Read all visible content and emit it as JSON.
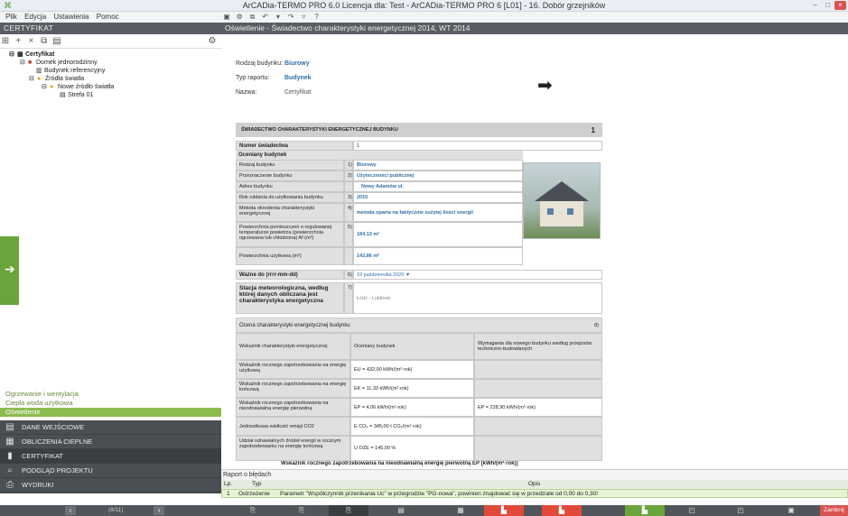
{
  "window": {
    "title": "ArCADia-TERMO PRO 6.0 Licencja dla: Test - ArCADia-TERMO PRO 6 [L01] - 16. Dobór grzejników",
    "minimize": "–",
    "restore": "□",
    "close": "×"
  },
  "menu": [
    "Plik",
    "Edycja",
    "Ustawienia",
    "Pomoc"
  ],
  "left_panel": {
    "header": "CERTYFIKAT",
    "tree": [
      {
        "label": "Certyfikat",
        "icon": "certificate-icon"
      },
      {
        "label": "Domek jednorodzinny",
        "icon": "building-icon"
      },
      {
        "label": "Budynek referencyjny",
        "icon": "building-reference-icon"
      },
      {
        "label": "Źródła światła",
        "icon": "light-sources-icon"
      },
      {
        "label": "Nowe źródło światła",
        "icon": "bulb-icon"
      },
      {
        "label": "Strefa 01",
        "icon": "zone-icon"
      }
    ],
    "subitems": [
      "Ogrzewanie i wentylacja",
      "Ciepła woda użytkowa",
      "Oświetlenie"
    ],
    "nav": [
      "DANE WEJŚCIOWE",
      "OBLICZENIA CIEPLNE",
      "CERTYFIKAT",
      "PODGLĄD PROJEKTU",
      "WYDRUKI"
    ],
    "pager": "(8/11)"
  },
  "doc_header": "Oświetlenie - Świadectwo charakterystyki energetycznej 2014, WT 2014",
  "doc_top": {
    "rodzaj_label": "Rodzaj budynku:",
    "rodzaj_value": "Biurowy",
    "typ_label": "Typ raportu:",
    "typ_value": "Budynek",
    "nazwa_label": "Nazwa:",
    "nazwa_value": "Certyfikat"
  },
  "cert": {
    "title": "ŚWIADECTWO CHARAKTERYSTYKI ENERGETYCZNEJ BUDYNKU",
    "page": "1",
    "numer_label": "Numer świadectwa",
    "numer_value": "1",
    "oceniany": "Oceniany budynek",
    "rows": [
      {
        "label": "Rodzaj budynku",
        "idx": "1)",
        "value": "Biurowy"
      },
      {
        "label": "Przeznaczenie budynku",
        "idx": "2)",
        "value": "Użyteczności publicznej"
      },
      {
        "label": "Adres budynku",
        "idx": "",
        "value": "Nowy Adamów ul."
      },
      {
        "label": "Rok oddania do użytkowania budynku",
        "idx": "3)",
        "value": "2010"
      },
      {
        "label": "Metoda określenia charakterystyki energetycznej",
        "idx": "4)",
        "value": "metoda oparta na faktycznie zużytej ilości energii"
      },
      {
        "label": "Powierzchnia pomieszczeń o regulowanej temperaturze powietrza (powierzchnia ogrzewana lub chłodzona) Af (m²)",
        "idx": "5)",
        "value": "184,13 m²"
      },
      {
        "label": "Powierzchnia użytkowa (m²)",
        "idx": "",
        "value": "142,86 m²"
      }
    ],
    "wazne_label": "Ważne do (rrrr-mm-dd)",
    "wazne_idx": "6)",
    "wazne_value": "19 października 2020 ▼",
    "stacja_label": "Stacja meteorologiczna, według której danych obliczana jest charakterystyka energetyczna",
    "stacja_idx": "7)",
    "stacja_value": "Łódź - Lublinek",
    "ocena_title": "Ocena charakterystyki energetycznej budynku",
    "ocena_idx": "8)",
    "ocena_cols": [
      "Wskaźnik charakterystyki energetycznej",
      "Oceniany budynek",
      "Wymagania dla nowego budynku według przepisów techniczno-budowlanych"
    ],
    "ocena_rows": [
      {
        "label": "Wskaźnik rocznego zapotrzebowania na energię użytkową",
        "value": "EU = 432,00 kWh/(m²·rok)",
        "req": ""
      },
      {
        "label": "Wskaźnik rocznego zapotrzebowania na energię końcową",
        "value": "EK = 11,33 kWh/(m²·rok)",
        "req": ""
      },
      {
        "label": "Wskaźnik rocznego zapotrzebowania na nieodnawialną energię pierwotną",
        "value": "EP = 4,06 kWh/(m²·rok)",
        "req": "EP = 228,90 kWh/(m²·rok)"
      },
      {
        "label": "Jednostkowa wielkość emisji CO2",
        "value": "E CO₂ = 345,00 t CO₂/(m²·rok)",
        "req": ""
      },
      {
        "label": "Udział odnawialnych źródeł energii w rocznym zapotrzebowaniu na energię końcową",
        "value": "U OZE = 145,00 %",
        "req": ""
      }
    ],
    "cut_text": "Wskaźnik rocznego zapotrzebowania na nieodnawialną energię pierwotną EP [kWh/(m²·rok)]"
  },
  "reports": {
    "title": "Raport o błędach",
    "cols": [
      "Lp.",
      "Typ",
      "Opis"
    ],
    "row": {
      "lp": "1",
      "typ": "Ostrzeżenie",
      "opis": "Parametr \"Współczynnik przenikania Uc\" w przegrodzie \"PG-nowa\", powinien znajdować się w przedziale od 0,00 do 0,30!"
    }
  },
  "bottom": {
    "zamknij": "Zamknij"
  }
}
